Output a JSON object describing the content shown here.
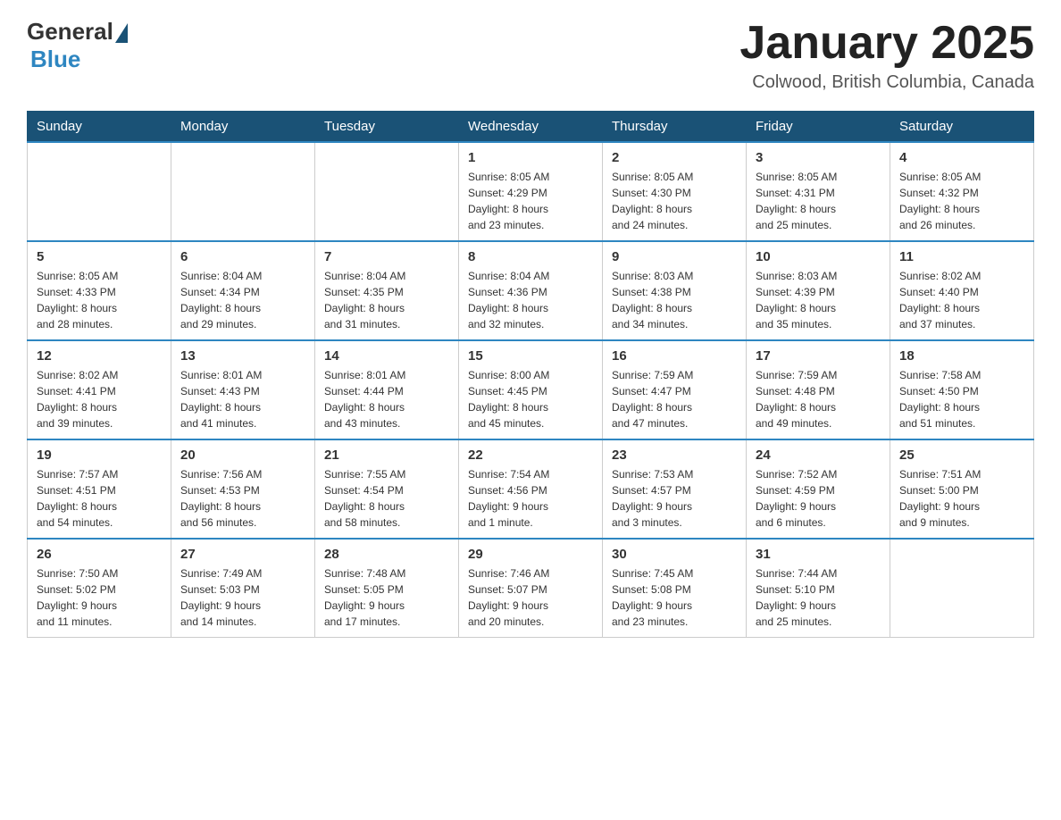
{
  "header": {
    "logo_general": "General",
    "logo_blue": "Blue",
    "title": "January 2025",
    "subtitle": "Colwood, British Columbia, Canada"
  },
  "days_of_week": [
    "Sunday",
    "Monday",
    "Tuesday",
    "Wednesday",
    "Thursday",
    "Friday",
    "Saturday"
  ],
  "weeks": [
    [
      {
        "day": "",
        "info": ""
      },
      {
        "day": "",
        "info": ""
      },
      {
        "day": "",
        "info": ""
      },
      {
        "day": "1",
        "info": "Sunrise: 8:05 AM\nSunset: 4:29 PM\nDaylight: 8 hours\nand 23 minutes."
      },
      {
        "day": "2",
        "info": "Sunrise: 8:05 AM\nSunset: 4:30 PM\nDaylight: 8 hours\nand 24 minutes."
      },
      {
        "day": "3",
        "info": "Sunrise: 8:05 AM\nSunset: 4:31 PM\nDaylight: 8 hours\nand 25 minutes."
      },
      {
        "day": "4",
        "info": "Sunrise: 8:05 AM\nSunset: 4:32 PM\nDaylight: 8 hours\nand 26 minutes."
      }
    ],
    [
      {
        "day": "5",
        "info": "Sunrise: 8:05 AM\nSunset: 4:33 PM\nDaylight: 8 hours\nand 28 minutes."
      },
      {
        "day": "6",
        "info": "Sunrise: 8:04 AM\nSunset: 4:34 PM\nDaylight: 8 hours\nand 29 minutes."
      },
      {
        "day": "7",
        "info": "Sunrise: 8:04 AM\nSunset: 4:35 PM\nDaylight: 8 hours\nand 31 minutes."
      },
      {
        "day": "8",
        "info": "Sunrise: 8:04 AM\nSunset: 4:36 PM\nDaylight: 8 hours\nand 32 minutes."
      },
      {
        "day": "9",
        "info": "Sunrise: 8:03 AM\nSunset: 4:38 PM\nDaylight: 8 hours\nand 34 minutes."
      },
      {
        "day": "10",
        "info": "Sunrise: 8:03 AM\nSunset: 4:39 PM\nDaylight: 8 hours\nand 35 minutes."
      },
      {
        "day": "11",
        "info": "Sunrise: 8:02 AM\nSunset: 4:40 PM\nDaylight: 8 hours\nand 37 minutes."
      }
    ],
    [
      {
        "day": "12",
        "info": "Sunrise: 8:02 AM\nSunset: 4:41 PM\nDaylight: 8 hours\nand 39 minutes."
      },
      {
        "day": "13",
        "info": "Sunrise: 8:01 AM\nSunset: 4:43 PM\nDaylight: 8 hours\nand 41 minutes."
      },
      {
        "day": "14",
        "info": "Sunrise: 8:01 AM\nSunset: 4:44 PM\nDaylight: 8 hours\nand 43 minutes."
      },
      {
        "day": "15",
        "info": "Sunrise: 8:00 AM\nSunset: 4:45 PM\nDaylight: 8 hours\nand 45 minutes."
      },
      {
        "day": "16",
        "info": "Sunrise: 7:59 AM\nSunset: 4:47 PM\nDaylight: 8 hours\nand 47 minutes."
      },
      {
        "day": "17",
        "info": "Sunrise: 7:59 AM\nSunset: 4:48 PM\nDaylight: 8 hours\nand 49 minutes."
      },
      {
        "day": "18",
        "info": "Sunrise: 7:58 AM\nSunset: 4:50 PM\nDaylight: 8 hours\nand 51 minutes."
      }
    ],
    [
      {
        "day": "19",
        "info": "Sunrise: 7:57 AM\nSunset: 4:51 PM\nDaylight: 8 hours\nand 54 minutes."
      },
      {
        "day": "20",
        "info": "Sunrise: 7:56 AM\nSunset: 4:53 PM\nDaylight: 8 hours\nand 56 minutes."
      },
      {
        "day": "21",
        "info": "Sunrise: 7:55 AM\nSunset: 4:54 PM\nDaylight: 8 hours\nand 58 minutes."
      },
      {
        "day": "22",
        "info": "Sunrise: 7:54 AM\nSunset: 4:56 PM\nDaylight: 9 hours\nand 1 minute."
      },
      {
        "day": "23",
        "info": "Sunrise: 7:53 AM\nSunset: 4:57 PM\nDaylight: 9 hours\nand 3 minutes."
      },
      {
        "day": "24",
        "info": "Sunrise: 7:52 AM\nSunset: 4:59 PM\nDaylight: 9 hours\nand 6 minutes."
      },
      {
        "day": "25",
        "info": "Sunrise: 7:51 AM\nSunset: 5:00 PM\nDaylight: 9 hours\nand 9 minutes."
      }
    ],
    [
      {
        "day": "26",
        "info": "Sunrise: 7:50 AM\nSunset: 5:02 PM\nDaylight: 9 hours\nand 11 minutes."
      },
      {
        "day": "27",
        "info": "Sunrise: 7:49 AM\nSunset: 5:03 PM\nDaylight: 9 hours\nand 14 minutes."
      },
      {
        "day": "28",
        "info": "Sunrise: 7:48 AM\nSunset: 5:05 PM\nDaylight: 9 hours\nand 17 minutes."
      },
      {
        "day": "29",
        "info": "Sunrise: 7:46 AM\nSunset: 5:07 PM\nDaylight: 9 hours\nand 20 minutes."
      },
      {
        "day": "30",
        "info": "Sunrise: 7:45 AM\nSunset: 5:08 PM\nDaylight: 9 hours\nand 23 minutes."
      },
      {
        "day": "31",
        "info": "Sunrise: 7:44 AM\nSunset: 5:10 PM\nDaylight: 9 hours\nand 25 minutes."
      },
      {
        "day": "",
        "info": ""
      }
    ]
  ]
}
